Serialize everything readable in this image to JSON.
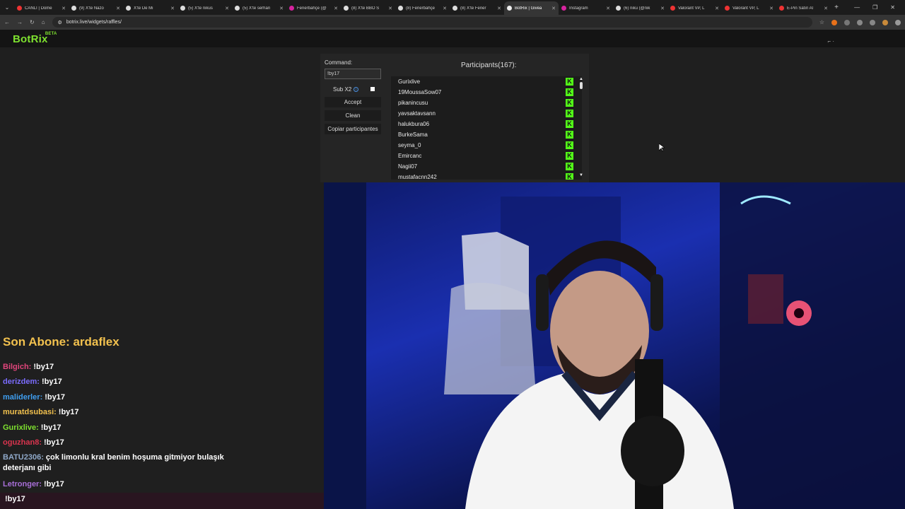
{
  "browser": {
    "tabs": [
      {
        "title": "CANLI | Dome",
        "fav": "#e33"
      },
      {
        "title": "(9) X'te Nazo",
        "fav": "#ddd"
      },
      {
        "title": "X'te De Mi",
        "fav": "#ddd"
      },
      {
        "title": "(5) X'te nikus",
        "fav": "#ddd"
      },
      {
        "title": "(5) X'te serhan",
        "fav": "#ddd"
      },
      {
        "title": "Fenerbahçe (@",
        "fav": "#d6249f"
      },
      {
        "title": "(8) X'te BBO S",
        "fav": "#ddd"
      },
      {
        "title": "(8) Fenerbahçe",
        "fav": "#ddd"
      },
      {
        "title": "(8) X'te Fener",
        "fav": "#ddd"
      },
      {
        "title": "BotRix | Givea",
        "fav": "#eee",
        "active": true
      },
      {
        "title": "Instagram",
        "fav": "#d6249f"
      },
      {
        "title": "(6) niku (@nik",
        "fav": "#ddd"
      },
      {
        "title": "Valorant VP, L",
        "fav": "#e33"
      },
      {
        "title": "Valorant VP, L",
        "fav": "#e33"
      },
      {
        "title": "E-Pin Satın Al",
        "fav": "#e33"
      }
    ],
    "url": "botrix.live/widgets/raffles/"
  },
  "site": {
    "logo": "BotRix",
    "beta": "BETA"
  },
  "raffle": {
    "command_label": "Command:",
    "command_value": "!by17",
    "sub_label": "Sub X2",
    "accept_label": "Accept",
    "clean_label": "Clean",
    "copy_label": "Copiar participantes",
    "participants_title": "Participants(167):",
    "participants": [
      "Gurixlive",
      "19MoussaSow07",
      "pikanincusu",
      "yavsaktavsann",
      "halukbura06",
      "BurkeSama",
      "seyma_0",
      "Emircanc",
      "Nagii07",
      "mustafacnn242"
    ]
  },
  "chat": {
    "son_abone": "Son Abone: ardaflex",
    "messages": [
      {
        "user": "Bilgich:",
        "text": "!by17",
        "color": "#e0457b"
      },
      {
        "user": "derizdem:",
        "text": "!by17",
        "color": "#7b6cff"
      },
      {
        "user": "maliderler:",
        "text": "!by17",
        "color": "#3f9ef0"
      },
      {
        "user": "muratdsubasi:",
        "text": "!by17",
        "color": "#f2c14e"
      },
      {
        "user": "Gurixlive:",
        "text": "!by17",
        "color": "#7ee12f"
      },
      {
        "user": "oguzhan8:",
        "text": "!by17",
        "color": "#d9344e"
      },
      {
        "user": "BATU2306:",
        "text": "çok limonlu kral benim hoşuma gitmiyor bulaşık deterjanı gibi",
        "color": "#8fa8c8"
      },
      {
        "user": "Letronger:",
        "text": "!by17",
        "color": "#a86fd8"
      },
      {
        "user": "",
        "text": "!by17",
        "color": "#e36bd6"
      }
    ]
  }
}
